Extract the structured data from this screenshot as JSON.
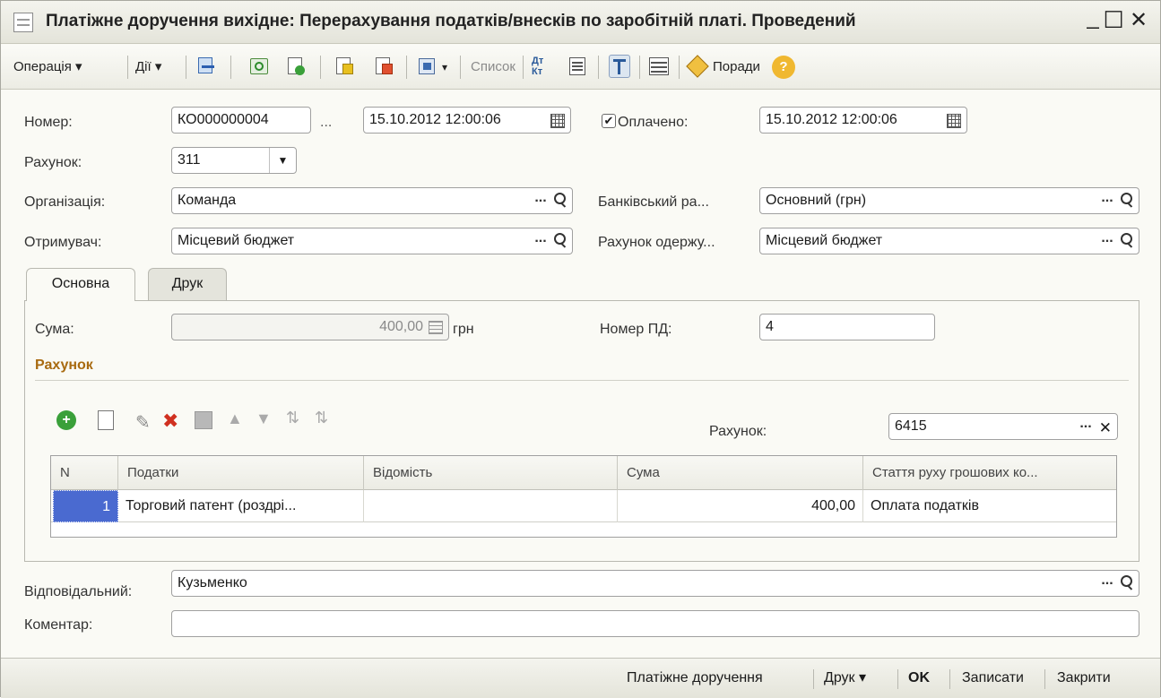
{
  "window": {
    "title": "Платіжне доручення вихідне: Перерахування податків/внесків по заробітній платі. Проведений",
    "minimize": "_",
    "maximize": "☐",
    "close": "✕"
  },
  "toolbar": {
    "operation": "Операція ▾",
    "actions": "Дії ▾",
    "list": "Список",
    "tips": "Поради",
    "help": "?",
    "dt_kt": "Дт Кт"
  },
  "form": {
    "number_label": "Номер:",
    "number_value": "КО000000004",
    "number_dots": "...",
    "date_value": "15.10.2012 12:00:06",
    "paid_label": "Оплачено:",
    "paid_date_value": "15.10.2012 12:00:06",
    "account_label": "Рахунок:",
    "account_value": "311",
    "org_label": "Організація:",
    "org_value": "Команда",
    "bank_acc_label": "Банківський ра...",
    "bank_acc_value": "Основний (грн)",
    "recipient_label": "Отримувач:",
    "recipient_value": "Місцевий бюджет",
    "recipient_acc_label": "Рахунок одержу...",
    "recipient_acc_value": "Місцевий бюджет"
  },
  "tabs": [
    {
      "label": "Основна"
    },
    {
      "label": "Друк"
    }
  ],
  "main": {
    "sum_label": "Сума:",
    "sum_value": "400,00",
    "currency": "грн",
    "pd_number_label": "Номер ПД:",
    "pd_number_value": "4",
    "section_title": "Рахунок",
    "grid_account_label": "Рахунок:",
    "grid_account_value": "6415"
  },
  "grid": {
    "columns": [
      "N",
      "Податки",
      "Відомість",
      "Сума",
      "Стаття руху грошових ко..."
    ],
    "rows": [
      [
        "1",
        "Торговий патент (роздрі...",
        "",
        "400,00",
        "Оплата податків"
      ]
    ]
  },
  "footer": {
    "responsible_label": "Відповідальний:",
    "responsible_value": "Кузьменко",
    "comment_label": "Коментар:",
    "comment_value": ""
  },
  "bottombar": {
    "payment_order": "Платіжне доручення",
    "print": "Друк ▾",
    "ok": "OK",
    "save": "Записати",
    "close": "Закрити"
  }
}
